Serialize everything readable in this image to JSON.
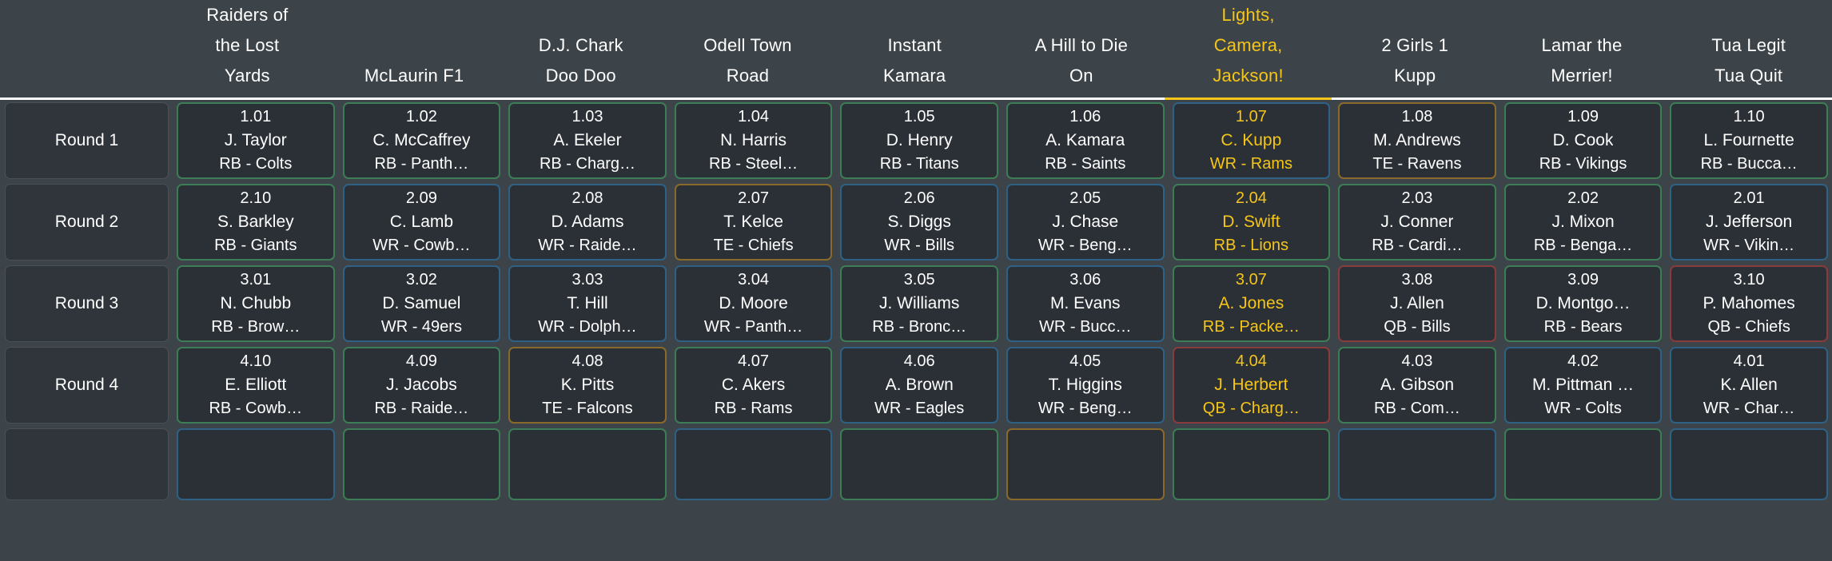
{
  "colors": {
    "background": "#3d4449",
    "cell_background": "#2b3036",
    "text": "#ffffff",
    "highlight": "#f5c518",
    "border_rb": "#3c7d56",
    "border_wr": "#2e6184",
    "border_te": "#8a6a2b",
    "border_qb": "#8a3b3b"
  },
  "header": {
    "corner_label": "",
    "teams": [
      {
        "name": "Raiders of\nthe Lost\nYards",
        "active": false
      },
      {
        "name": "McLaurin F1",
        "active": false
      },
      {
        "name": "D.J. Chark\nDoo Doo",
        "active": false
      },
      {
        "name": "Odell Town\nRoad",
        "active": false
      },
      {
        "name": "Instant\nKamara",
        "active": false
      },
      {
        "name": "A Hill to Die\nOn",
        "active": false
      },
      {
        "name": "Lights,\nCamera,\nJackson!",
        "active": true
      },
      {
        "name": "2 Girls 1\nKupp",
        "active": false
      },
      {
        "name": "Lamar the\nMerrier!",
        "active": false
      },
      {
        "name": "Tua Legit\nTua Quit",
        "active": false
      }
    ]
  },
  "rounds": [
    {
      "label": "Round 1",
      "picks": [
        {
          "pick": "1.01",
          "player": "J. Taylor",
          "meta": "RB - Colts",
          "pos": "RB",
          "highlight": false
        },
        {
          "pick": "1.02",
          "player": "C. McCaffrey",
          "meta": "RB - Panth…",
          "pos": "RB",
          "highlight": false
        },
        {
          "pick": "1.03",
          "player": "A. Ekeler",
          "meta": "RB - Charg…",
          "pos": "RB",
          "highlight": false
        },
        {
          "pick": "1.04",
          "player": "N. Harris",
          "meta": "RB - Steel…",
          "pos": "RB",
          "highlight": false
        },
        {
          "pick": "1.05",
          "player": "D. Henry",
          "meta": "RB - Titans",
          "pos": "RB",
          "highlight": false
        },
        {
          "pick": "1.06",
          "player": "A. Kamara",
          "meta": "RB - Saints",
          "pos": "RB",
          "highlight": false
        },
        {
          "pick": "1.07",
          "player": "C. Kupp",
          "meta": "WR - Rams",
          "pos": "WR",
          "highlight": true
        },
        {
          "pick": "1.08",
          "player": "M. Andrews",
          "meta": "TE - Ravens",
          "pos": "TE",
          "highlight": false
        },
        {
          "pick": "1.09",
          "player": "D. Cook",
          "meta": "RB - Vikings",
          "pos": "RB",
          "highlight": false
        },
        {
          "pick": "1.10",
          "player": "L. Fournette",
          "meta": "RB - Bucca…",
          "pos": "RB",
          "highlight": false
        }
      ]
    },
    {
      "label": "Round 2",
      "picks": [
        {
          "pick": "2.10",
          "player": "S. Barkley",
          "meta": "RB - Giants",
          "pos": "RB",
          "highlight": false
        },
        {
          "pick": "2.09",
          "player": "C. Lamb",
          "meta": "WR - Cowb…",
          "pos": "WR",
          "highlight": false
        },
        {
          "pick": "2.08",
          "player": "D. Adams",
          "meta": "WR - Raide…",
          "pos": "WR",
          "highlight": false
        },
        {
          "pick": "2.07",
          "player": "T. Kelce",
          "meta": "TE - Chiefs",
          "pos": "TE",
          "highlight": false
        },
        {
          "pick": "2.06",
          "player": "S. Diggs",
          "meta": "WR - Bills",
          "pos": "WR",
          "highlight": false
        },
        {
          "pick": "2.05",
          "player": "J. Chase",
          "meta": "WR - Beng…",
          "pos": "WR",
          "highlight": false
        },
        {
          "pick": "2.04",
          "player": "D. Swift",
          "meta": "RB - Lions",
          "pos": "RB",
          "highlight": true
        },
        {
          "pick": "2.03",
          "player": "J. Conner",
          "meta": "RB - Cardi…",
          "pos": "RB",
          "highlight": false
        },
        {
          "pick": "2.02",
          "player": "J. Mixon",
          "meta": "RB - Benga…",
          "pos": "RB",
          "highlight": false
        },
        {
          "pick": "2.01",
          "player": "J. Jefferson",
          "meta": "WR - Vikin…",
          "pos": "WR",
          "highlight": false
        }
      ]
    },
    {
      "label": "Round 3",
      "picks": [
        {
          "pick": "3.01",
          "player": "N. Chubb",
          "meta": "RB - Brow…",
          "pos": "RB",
          "highlight": false
        },
        {
          "pick": "3.02",
          "player": "D. Samuel",
          "meta": "WR - 49ers",
          "pos": "WR",
          "highlight": false
        },
        {
          "pick": "3.03",
          "player": "T. Hill",
          "meta": "WR - Dolph…",
          "pos": "WR",
          "highlight": false
        },
        {
          "pick": "3.04",
          "player": "D. Moore",
          "meta": "WR - Panth…",
          "pos": "WR",
          "highlight": false
        },
        {
          "pick": "3.05",
          "player": "J. Williams",
          "meta": "RB - Bronc…",
          "pos": "RB",
          "highlight": false
        },
        {
          "pick": "3.06",
          "player": "M. Evans",
          "meta": "WR - Bucc…",
          "pos": "WR",
          "highlight": false
        },
        {
          "pick": "3.07",
          "player": "A. Jones",
          "meta": "RB - Packe…",
          "pos": "RB",
          "highlight": true
        },
        {
          "pick": "3.08",
          "player": "J. Allen",
          "meta": "QB - Bills",
          "pos": "QB",
          "highlight": false
        },
        {
          "pick": "3.09",
          "player": "D. Montgo…",
          "meta": "RB - Bears",
          "pos": "RB",
          "highlight": false
        },
        {
          "pick": "3.10",
          "player": "P. Mahomes",
          "meta": "QB - Chiefs",
          "pos": "QB",
          "highlight": false
        }
      ]
    },
    {
      "label": "Round 4",
      "picks": [
        {
          "pick": "4.10",
          "player": "E. Elliott",
          "meta": "RB - Cowb…",
          "pos": "RB",
          "highlight": false
        },
        {
          "pick": "4.09",
          "player": "J. Jacobs",
          "meta": "RB - Raide…",
          "pos": "RB",
          "highlight": false
        },
        {
          "pick": "4.08",
          "player": "K. Pitts",
          "meta": "TE - Falcons",
          "pos": "TE",
          "highlight": false
        },
        {
          "pick": "4.07",
          "player": "C. Akers",
          "meta": "RB - Rams",
          "pos": "RB",
          "highlight": false
        },
        {
          "pick": "4.06",
          "player": "A. Brown",
          "meta": "WR - Eagles",
          "pos": "WR",
          "highlight": false
        },
        {
          "pick": "4.05",
          "player": "T. Higgins",
          "meta": "WR - Beng…",
          "pos": "WR",
          "highlight": false
        },
        {
          "pick": "4.04",
          "player": "J. Herbert",
          "meta": "QB - Charg…",
          "pos": "QB",
          "highlight": true
        },
        {
          "pick": "4.03",
          "player": "A. Gibson",
          "meta": "RB - Com…",
          "pos": "RB",
          "highlight": false
        },
        {
          "pick": "4.02",
          "player": "M. Pittman …",
          "meta": "WR - Colts",
          "pos": "WR",
          "highlight": false
        },
        {
          "pick": "4.01",
          "player": "K. Allen",
          "meta": "WR - Char…",
          "pos": "WR",
          "highlight": false
        }
      ]
    },
    {
      "label": "",
      "partial": true,
      "picks": [
        {
          "pick": "",
          "player": "",
          "meta": "",
          "pos": "WR",
          "highlight": false
        },
        {
          "pick": "",
          "player": "",
          "meta": "",
          "pos": "RB",
          "highlight": false
        },
        {
          "pick": "",
          "player": "",
          "meta": "",
          "pos": "RB",
          "highlight": false
        },
        {
          "pick": "",
          "player": "",
          "meta": "",
          "pos": "WR",
          "highlight": false
        },
        {
          "pick": "",
          "player": "",
          "meta": "",
          "pos": "RB",
          "highlight": false
        },
        {
          "pick": "",
          "player": "",
          "meta": "",
          "pos": "TE",
          "highlight": false
        },
        {
          "pick": "",
          "player": "",
          "meta": "",
          "pos": "RB",
          "highlight": false
        },
        {
          "pick": "",
          "player": "",
          "meta": "",
          "pos": "WR",
          "highlight": false
        },
        {
          "pick": "",
          "player": "",
          "meta": "",
          "pos": "RB",
          "highlight": false
        },
        {
          "pick": "",
          "player": "",
          "meta": "",
          "pos": "WR",
          "highlight": false
        }
      ]
    }
  ]
}
